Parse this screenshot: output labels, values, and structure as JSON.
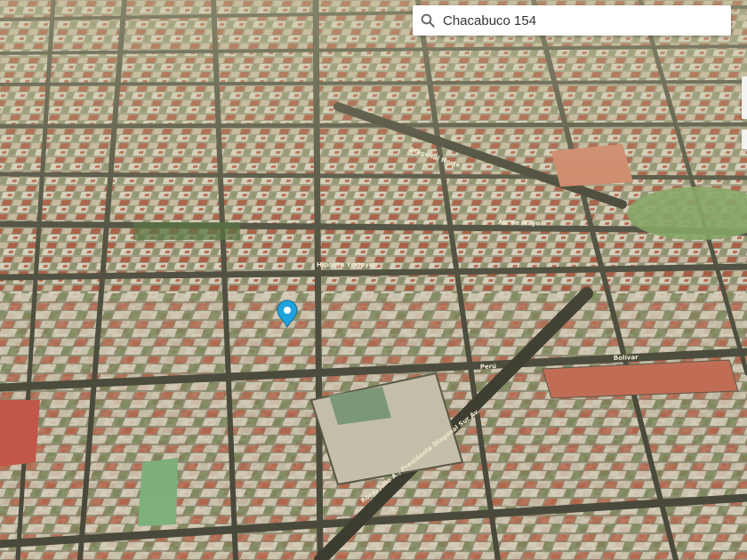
{
  "search": {
    "value": "Chacabuco 154",
    "icon": "search-icon"
  },
  "map": {
    "view": "3d-satellite",
    "marker_color": "#1fa3e0",
    "street_labels": [
      "Roca, Julio A., Presidente Diagonal Sur Av.",
      "Hipólito Yrigoyen",
      "Av. de Mayo",
      "Perú",
      "Bolívar",
      "Diagonal Norte"
    ]
  },
  "controls": {
    "zoom": "zoom-control",
    "compass": "compass-control"
  }
}
